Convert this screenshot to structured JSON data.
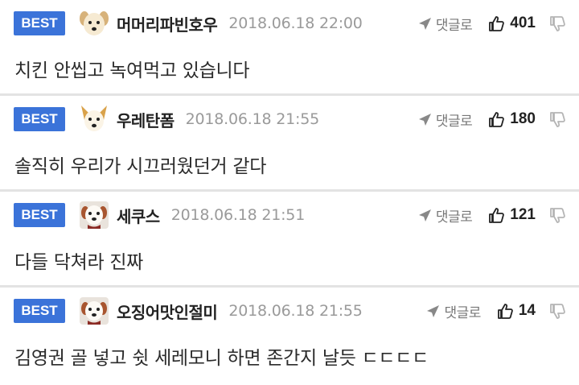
{
  "comments": [
    {
      "badge": "BEST",
      "avatar": "dog-face-avatar",
      "nickname": "머머리파빈호우",
      "date": "2018.06.18 22:00",
      "reply_label": "댓글로",
      "likes": "401",
      "text": "치킨 안씹고 녹여먹고 있습니다"
    },
    {
      "badge": "BEST",
      "avatar": "dog-face-avatar",
      "nickname": "우레탄폼",
      "date": "2018.06.18 21:55",
      "reply_label": "댓글로",
      "likes": "180",
      "text": "솔직히 우리가 시끄러웠던거 같다"
    },
    {
      "badge": "BEST",
      "avatar": "dog-face-avatar",
      "nickname": "세쿠스",
      "date": "2018.06.18 21:51",
      "reply_label": "댓글로",
      "likes": "121",
      "text": "다들 닥쳐라 진짜"
    },
    {
      "badge": "BEST",
      "avatar": "dog-face-avatar",
      "nickname": "오징어맛인절미",
      "date": "2018.06.18 21:55",
      "reply_label": "댓글로",
      "likes": "14",
      "text": "김영권 골 넣고 쉿 세레모니 하면 존간지 날듯 ㄷㄷㄷㄷ"
    }
  ],
  "colors": {
    "badge_bg": "#3b73d9",
    "divider": "#e3e3e3",
    "date_text": "#9a9a9a"
  }
}
